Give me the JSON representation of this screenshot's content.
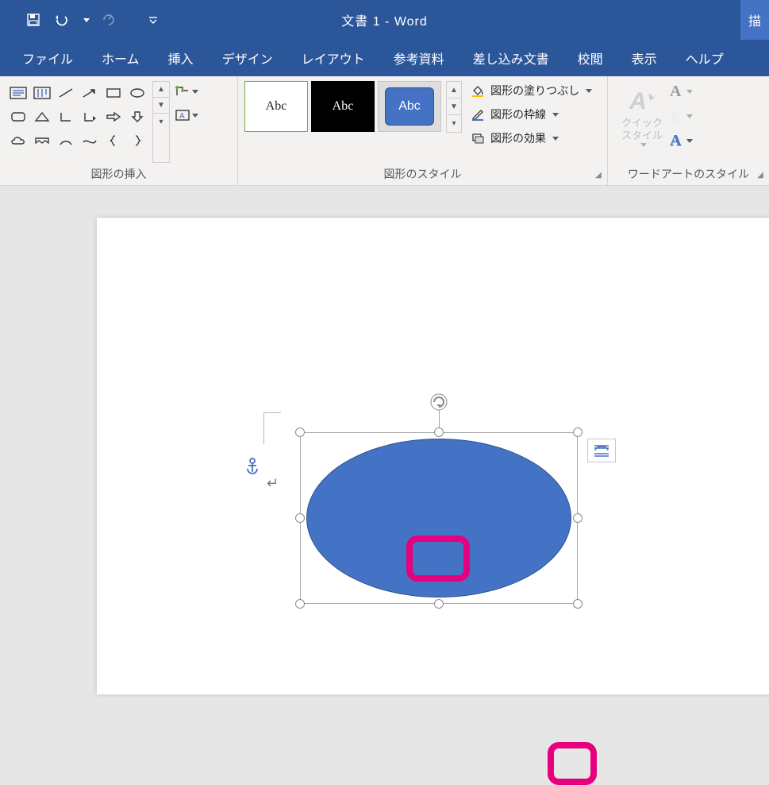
{
  "titlebar": {
    "doc_title": "文書 1",
    "separator": " - ",
    "app_name": "Word",
    "right_tab": "描"
  },
  "tabs": {
    "file": "ファイル",
    "home": "ホーム",
    "insert": "挿入",
    "design": "デザイン",
    "layout": "レイアウト",
    "references": "参考資料",
    "mailings": "差し込み文書",
    "review": "校閲",
    "view": "表示",
    "help": "ヘルプ"
  },
  "ribbon": {
    "group1_label": "図形の挿入",
    "group2_label": "図形のスタイル",
    "group3_label": "ワードアートのスタイル",
    "abc": "Abc",
    "shape_fill": "図形の塗りつぶし",
    "shape_outline": "図形の枠線",
    "shape_effects": "図形の効果",
    "quick_style_l1": "クイック",
    "quick_style_l2": "スタイル"
  },
  "canvas": {
    "para": "↵"
  }
}
